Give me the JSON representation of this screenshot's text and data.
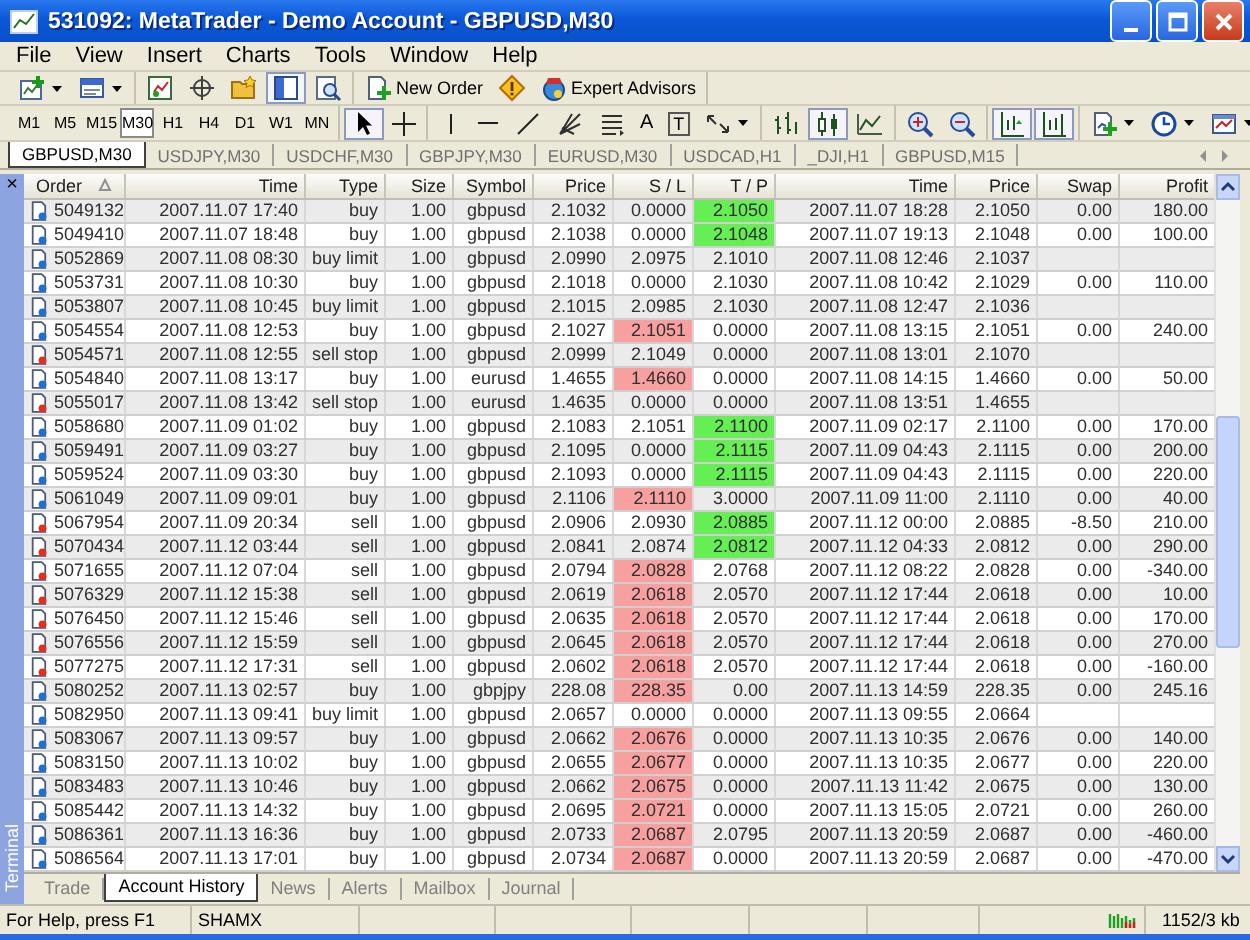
{
  "window": {
    "title": "531092: MetaTrader - Demo Account - GBPUSD,M30"
  },
  "menu": [
    "File",
    "View",
    "Insert",
    "Charts",
    "Tools",
    "Window",
    "Help"
  ],
  "toolbar": [
    [
      {
        "kind": "new-chart",
        "pressed": false,
        "dropdown": true
      },
      {
        "kind": "profiles",
        "pressed": false,
        "dropdown": true
      }
    ],
    [
      {
        "kind": "market-watch",
        "pressed": false,
        "dropdown": false
      },
      {
        "kind": "navigator",
        "pressed": false,
        "dropdown": false
      },
      {
        "kind": "favorites",
        "pressed": false,
        "dropdown": false
      },
      {
        "kind": "terminal",
        "pressed": true,
        "dropdown": false
      },
      {
        "kind": "tester",
        "pressed": false,
        "dropdown": false
      }
    ],
    [
      {
        "kind": "new-order",
        "label": "New Order",
        "pressed": false,
        "dropdown": false
      },
      {
        "kind": "autotrading",
        "pressed": false,
        "dropdown": false
      },
      {
        "kind": "experts",
        "label": "Expert Advisors",
        "pressed": false,
        "dropdown": false
      }
    ]
  ],
  "timeframes": [
    {
      "label": "M1",
      "selected": false
    },
    {
      "label": "M5",
      "selected": false
    },
    {
      "label": "M15",
      "selected": false
    },
    {
      "label": "M30",
      "selected": true
    },
    {
      "label": "H1",
      "selected": false
    },
    {
      "label": "H4",
      "selected": false
    },
    {
      "label": "D1",
      "selected": false
    },
    {
      "label": "W1",
      "selected": false
    },
    {
      "label": "MN",
      "selected": false
    }
  ],
  "tools": [
    [
      {
        "kind": "cursor",
        "pressed": true,
        "dropdown": false
      },
      {
        "kind": "crosshair",
        "pressed": false,
        "dropdown": false
      }
    ],
    [
      {
        "kind": "vline",
        "pressed": false,
        "dropdown": false
      },
      {
        "kind": "hline",
        "pressed": false,
        "dropdown": false
      },
      {
        "kind": "trendline",
        "pressed": false,
        "dropdown": false
      },
      {
        "kind": "pitchfork",
        "pressed": false,
        "dropdown": false
      },
      {
        "kind": "fibo",
        "pressed": false,
        "dropdown": false
      },
      {
        "kind": "text",
        "label": "A",
        "pressed": false,
        "dropdown": false
      },
      {
        "kind": "label",
        "label": "T",
        "pressed": false,
        "dropdown": false
      },
      {
        "kind": "arrows",
        "pressed": false,
        "dropdown": true
      }
    ]
  ],
  "chart_tools": [
    [
      {
        "kind": "bars",
        "pressed": false,
        "dropdown": false
      },
      {
        "kind": "candles",
        "pressed": true,
        "dropdown": false
      },
      {
        "kind": "line",
        "pressed": false,
        "dropdown": false
      }
    ],
    [
      {
        "kind": "zoom-in",
        "pressed": false,
        "dropdown": false
      },
      {
        "kind": "zoom-out",
        "pressed": false,
        "dropdown": false
      }
    ],
    [
      {
        "kind": "autoscroll",
        "pressed": true,
        "dropdown": false
      },
      {
        "kind": "shift",
        "pressed": true,
        "dropdown": false
      }
    ],
    [
      {
        "kind": "indicators",
        "pressed": false,
        "dropdown": true
      },
      {
        "kind": "periods",
        "pressed": false,
        "dropdown": true
      },
      {
        "kind": "templates",
        "pressed": false,
        "dropdown": true
      }
    ]
  ],
  "chart_tabs": [
    {
      "label": "GBPUSD,M30",
      "selected": true
    },
    {
      "label": "USDJPY,M30",
      "selected": false
    },
    {
      "label": "USDCHF,M30",
      "selected": false
    },
    {
      "label": "GBPJPY,M30",
      "selected": false
    },
    {
      "label": "EURUSD,M30",
      "selected": false
    },
    {
      "label": "USDCAD,H1",
      "selected": false
    },
    {
      "label": "_DJI,H1",
      "selected": false
    },
    {
      "label": "GBPUSD,M15",
      "selected": false
    }
  ],
  "terminal": {
    "close": "×",
    "label": "Terminal",
    "columns": [
      "Order",
      "Time",
      "Type",
      "Size",
      "Symbol",
      "Price",
      "S / L",
      "T / P",
      "Time",
      "Price",
      "Swap",
      "Profit"
    ],
    "rows": [
      {
        "order": "5049132",
        "time": "2007.11.07 17:40",
        "type": "buy",
        "size": "1.00",
        "symbol": "gbpusd",
        "price": "2.1032",
        "sl": "0.0000",
        "tp": "2.1050",
        "close_time": "2007.11.07 18:28",
        "close_price": "2.1050",
        "swap": "0.00",
        "profit": "180.00",
        "color": "#2070d0",
        "sl_hit": false,
        "tp_hit": true
      },
      {
        "order": "5049410",
        "time": "2007.11.07 18:48",
        "type": "buy",
        "size": "1.00",
        "symbol": "gbpusd",
        "price": "2.1038",
        "sl": "0.0000",
        "tp": "2.1048",
        "close_time": "2007.11.07 19:13",
        "close_price": "2.1048",
        "swap": "0.00",
        "profit": "100.00",
        "color": "#2070d0",
        "sl_hit": false,
        "tp_hit": true
      },
      {
        "order": "5052869",
        "time": "2007.11.08 08:30",
        "type": "buy limit",
        "size": "1.00",
        "symbol": "gbpusd",
        "price": "2.0990",
        "sl": "2.0975",
        "tp": "2.1010",
        "close_time": "2007.11.08 12:46",
        "close_price": "2.1037",
        "color": "#2070d0",
        "sl_hit": false,
        "tp_hit": false
      },
      {
        "order": "5053731",
        "time": "2007.11.08 10:30",
        "type": "buy",
        "size": "1.00",
        "symbol": "gbpusd",
        "price": "2.1018",
        "sl": "0.0000",
        "tp": "2.1030",
        "close_time": "2007.11.08 10:42",
        "close_price": "2.1029",
        "swap": "0.00",
        "profit": "110.00",
        "color": "#2070d0",
        "sl_hit": false,
        "tp_hit": false
      },
      {
        "order": "5053807",
        "time": "2007.11.08 10:45",
        "type": "buy limit",
        "size": "1.00",
        "symbol": "gbpusd",
        "price": "2.1015",
        "sl": "2.0985",
        "tp": "2.1030",
        "close_time": "2007.11.08 12:47",
        "close_price": "2.1036",
        "color": "#2070d0",
        "sl_hit": false,
        "tp_hit": false
      },
      {
        "order": "5054554",
        "time": "2007.11.08 12:53",
        "type": "buy",
        "size": "1.00",
        "symbol": "gbpusd",
        "price": "2.1027",
        "sl": "2.1051",
        "tp": "0.0000",
        "close_time": "2007.11.08 13:15",
        "close_price": "2.1051",
        "swap": "0.00",
        "profit": "240.00",
        "color": "#2070d0",
        "sl_hit": true,
        "tp_hit": false
      },
      {
        "order": "5054571",
        "time": "2007.11.08 12:55",
        "type": "sell stop",
        "size": "1.00",
        "symbol": "gbpusd",
        "price": "2.0999",
        "sl": "2.1049",
        "tp": "0.0000",
        "close_time": "2007.11.08 13:01",
        "close_price": "2.1070",
        "color": "#e03020",
        "sl_hit": false,
        "tp_hit": false
      },
      {
        "order": "5054840",
        "time": "2007.11.08 13:17",
        "type": "buy",
        "size": "1.00",
        "symbol": "eurusd",
        "price": "1.4655",
        "sl": "1.4660",
        "tp": "0.0000",
        "close_time": "2007.11.08 14:15",
        "close_price": "1.4660",
        "swap": "0.00",
        "profit": "50.00",
        "color": "#2070d0",
        "sl_hit": true,
        "tp_hit": false
      },
      {
        "order": "5055017",
        "time": "2007.11.08 13:42",
        "type": "sell stop",
        "size": "1.00",
        "symbol": "eurusd",
        "price": "1.4635",
        "sl": "0.0000",
        "tp": "0.0000",
        "close_time": "2007.11.08 13:51",
        "close_price": "1.4655",
        "color": "#e03020",
        "sl_hit": false,
        "tp_hit": false
      },
      {
        "order": "5058680",
        "time": "2007.11.09 01:02",
        "type": "buy",
        "size": "1.00",
        "symbol": "gbpusd",
        "price": "2.1083",
        "sl": "2.1051",
        "tp": "2.1100",
        "close_time": "2007.11.09 02:17",
        "close_price": "2.1100",
        "swap": "0.00",
        "profit": "170.00",
        "color": "#2070d0",
        "sl_hit": false,
        "tp_hit": true
      },
      {
        "order": "5059491",
        "time": "2007.11.09 03:27",
        "type": "buy",
        "size": "1.00",
        "symbol": "gbpusd",
        "price": "2.1095",
        "sl": "0.0000",
        "tp": "2.1115",
        "close_time": "2007.11.09 04:43",
        "close_price": "2.1115",
        "swap": "0.00",
        "profit": "200.00",
        "color": "#2070d0",
        "sl_hit": false,
        "tp_hit": true
      },
      {
        "order": "5059524",
        "time": "2007.11.09 03:30",
        "type": "buy",
        "size": "1.00",
        "symbol": "gbpusd",
        "price": "2.1093",
        "sl": "0.0000",
        "tp": "2.1115",
        "close_time": "2007.11.09 04:43",
        "close_price": "2.1115",
        "swap": "0.00",
        "profit": "220.00",
        "color": "#2070d0",
        "sl_hit": false,
        "tp_hit": true
      },
      {
        "order": "5061049",
        "time": "2007.11.09 09:01",
        "type": "buy",
        "size": "1.00",
        "symbol": "gbpusd",
        "price": "2.1106",
        "sl": "2.1110",
        "tp": "3.0000",
        "close_time": "2007.11.09 11:00",
        "close_price": "2.1110",
        "swap": "0.00",
        "profit": "40.00",
        "color": "#2070d0",
        "sl_hit": true,
        "tp_hit": false
      },
      {
        "order": "5067954",
        "time": "2007.11.09 20:34",
        "type": "sell",
        "size": "1.00",
        "symbol": "gbpusd",
        "price": "2.0906",
        "sl": "2.0930",
        "tp": "2.0885",
        "close_time": "2007.11.12 00:00",
        "close_price": "2.0885",
        "swap": "-8.50",
        "profit": "210.00",
        "color": "#e03020",
        "sl_hit": false,
        "tp_hit": true
      },
      {
        "order": "5070434",
        "time": "2007.11.12 03:44",
        "type": "sell",
        "size": "1.00",
        "symbol": "gbpusd",
        "price": "2.0841",
        "sl": "2.0874",
        "tp": "2.0812",
        "close_time": "2007.11.12 04:33",
        "close_price": "2.0812",
        "swap": "0.00",
        "profit": "290.00",
        "color": "#e03020",
        "sl_hit": false,
        "tp_hit": true
      },
      {
        "order": "5071655",
        "time": "2007.11.12 07:04",
        "type": "sell",
        "size": "1.00",
        "symbol": "gbpusd",
        "price": "2.0794",
        "sl": "2.0828",
        "tp": "2.0768",
        "close_time": "2007.11.12 08:22",
        "close_price": "2.0828",
        "swap": "0.00",
        "profit": "-340.00",
        "color": "#e03020",
        "sl_hit": true,
        "tp_hit": false
      },
      {
        "order": "5076329",
        "time": "2007.11.12 15:38",
        "type": "sell",
        "size": "1.00",
        "symbol": "gbpusd",
        "price": "2.0619",
        "sl": "2.0618",
        "tp": "2.0570",
        "close_time": "2007.11.12 17:44",
        "close_price": "2.0618",
        "swap": "0.00",
        "profit": "10.00",
        "color": "#e03020",
        "sl_hit": true,
        "tp_hit": false
      },
      {
        "order": "5076450",
        "time": "2007.11.12 15:46",
        "type": "sell",
        "size": "1.00",
        "symbol": "gbpusd",
        "price": "2.0635",
        "sl": "2.0618",
        "tp": "2.0570",
        "close_time": "2007.11.12 17:44",
        "close_price": "2.0618",
        "swap": "0.00",
        "profit": "170.00",
        "color": "#e03020",
        "sl_hit": true,
        "tp_hit": false
      },
      {
        "order": "5076556",
        "time": "2007.11.12 15:59",
        "type": "sell",
        "size": "1.00",
        "symbol": "gbpusd",
        "price": "2.0645",
        "sl": "2.0618",
        "tp": "2.0570",
        "close_time": "2007.11.12 17:44",
        "close_price": "2.0618",
        "swap": "0.00",
        "profit": "270.00",
        "color": "#e03020",
        "sl_hit": true,
        "tp_hit": false
      },
      {
        "order": "5077275",
        "time": "2007.11.12 17:31",
        "type": "sell",
        "size": "1.00",
        "symbol": "gbpusd",
        "price": "2.0602",
        "sl": "2.0618",
        "tp": "2.0570",
        "close_time": "2007.11.12 17:44",
        "close_price": "2.0618",
        "swap": "0.00",
        "profit": "-160.00",
        "color": "#e03020",
        "sl_hit": true,
        "tp_hit": false
      },
      {
        "order": "5080252",
        "time": "2007.11.13 02:57",
        "type": "buy",
        "size": "1.00",
        "symbol": "gbpjpy",
        "price": "228.08",
        "sl": "228.35",
        "tp": "0.00",
        "close_time": "2007.11.13 14:59",
        "close_price": "228.35",
        "swap": "0.00",
        "profit": "245.16",
        "color": "#2070d0",
        "sl_hit": true,
        "tp_hit": false
      },
      {
        "order": "5082950",
        "time": "2007.11.13 09:41",
        "type": "buy limit",
        "size": "1.00",
        "symbol": "gbpusd",
        "price": "2.0657",
        "sl": "0.0000",
        "tp": "0.0000",
        "close_time": "2007.11.13 09:55",
        "close_price": "2.0664",
        "color": "#2070d0",
        "sl_hit": false,
        "tp_hit": false
      },
      {
        "order": "5083067",
        "time": "2007.11.13 09:57",
        "type": "buy",
        "size": "1.00",
        "symbol": "gbpusd",
        "price": "2.0662",
        "sl": "2.0676",
        "tp": "0.0000",
        "close_time": "2007.11.13 10:35",
        "close_price": "2.0676",
        "swap": "0.00",
        "profit": "140.00",
        "color": "#2070d0",
        "sl_hit": true,
        "tp_hit": false
      },
      {
        "order": "5083150",
        "time": "2007.11.13 10:02",
        "type": "buy",
        "size": "1.00",
        "symbol": "gbpusd",
        "price": "2.0655",
        "sl": "2.0677",
        "tp": "0.0000",
        "close_time": "2007.11.13 10:35",
        "close_price": "2.0677",
        "swap": "0.00",
        "profit": "220.00",
        "color": "#2070d0",
        "sl_hit": true,
        "tp_hit": false
      },
      {
        "order": "5083483",
        "time": "2007.11.13 10:46",
        "type": "buy",
        "size": "1.00",
        "symbol": "gbpusd",
        "price": "2.0662",
        "sl": "2.0675",
        "tp": "0.0000",
        "close_time": "2007.11.13 11:42",
        "close_price": "2.0675",
        "swap": "0.00",
        "profit": "130.00",
        "color": "#2070d0",
        "sl_hit": true,
        "tp_hit": false
      },
      {
        "order": "5085442",
        "time": "2007.11.13 14:32",
        "type": "buy",
        "size": "1.00",
        "symbol": "gbpusd",
        "price": "2.0695",
        "sl": "2.0721",
        "tp": "0.0000",
        "close_time": "2007.11.13 15:05",
        "close_price": "2.0721",
        "swap": "0.00",
        "profit": "260.00",
        "color": "#2070d0",
        "sl_hit": true,
        "tp_hit": false
      },
      {
        "order": "5086361",
        "time": "2007.11.13 16:36",
        "type": "buy",
        "size": "1.00",
        "symbol": "gbpusd",
        "price": "2.0733",
        "sl": "2.0687",
        "tp": "2.0795",
        "close_time": "2007.11.13 20:59",
        "close_price": "2.0687",
        "swap": "0.00",
        "profit": "-460.00",
        "color": "#2070d0",
        "sl_hit": true,
        "tp_hit": false
      },
      {
        "order": "5086564",
        "time": "2007.11.13 17:01",
        "type": "buy",
        "size": "1.00",
        "symbol": "gbpusd",
        "price": "2.0734",
        "sl": "2.0687",
        "tp": "0.0000",
        "close_time": "2007.11.13 20:59",
        "close_price": "2.0687",
        "swap": "0.00",
        "profit": "-470.00",
        "color": "#2070d0",
        "sl_hit": true,
        "tp_hit": false
      }
    ],
    "tabs": [
      {
        "label": "Trade",
        "selected": false
      },
      {
        "label": "Account History",
        "selected": true
      },
      {
        "label": "News",
        "selected": false
      },
      {
        "label": "Alerts",
        "selected": false
      },
      {
        "label": "Mailbox",
        "selected": false
      },
      {
        "label": "Journal",
        "selected": false
      }
    ]
  },
  "status_bar": {
    "help": "For Help, press F1",
    "profile": "SHAMX",
    "traffic": "1152/3 kb"
  }
}
